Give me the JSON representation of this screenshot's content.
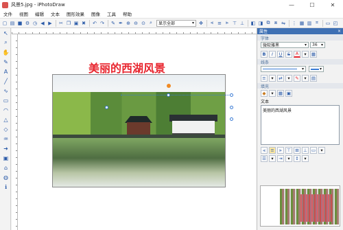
{
  "window": {
    "title": "风景5.jpg - iPhotoDraw",
    "minimize": "—",
    "maximize": "☐",
    "close": "✕"
  },
  "menu": [
    "文件",
    "视图",
    "编辑",
    "文本",
    "图形效果",
    "图像",
    "工具",
    "帮助"
  ],
  "toolbar": {
    "display_select": "显示全部"
  },
  "canvas": {
    "overlay_text": "美丽的西湖风景"
  },
  "panel": {
    "title": "属性",
    "close": "×",
    "font_section": "字体",
    "font_name": "微软雅黑",
    "font_size": "36",
    "bold": "B",
    "italic": "I",
    "underline": "U",
    "strike": "S",
    "line_section": "线条",
    "fill_section": "填充",
    "text_section": "文本",
    "text_value": "美丽的西湖风景"
  },
  "colors": {
    "text_red": "#e8242d",
    "panel_header": "#3d6fb4",
    "handle_orange": "#f08a24"
  }
}
